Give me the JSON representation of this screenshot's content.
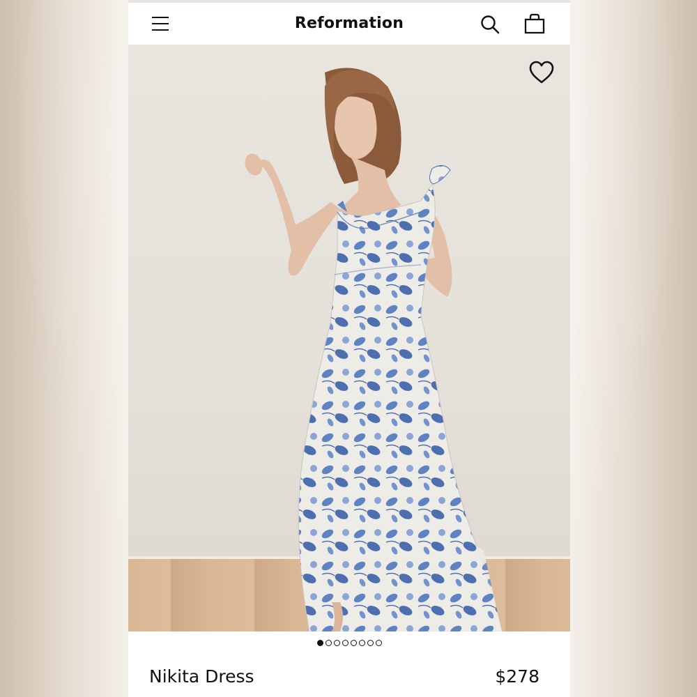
{
  "header": {
    "brand": "Reformation",
    "icons": [
      "menu-icon",
      "search-icon",
      "shopping-bag-icon"
    ]
  },
  "gallery": {
    "image_count": 8,
    "active_index": 0,
    "wishlist_icon": "heart-outline-icon"
  },
  "product": {
    "name": "Nikita Dress",
    "price": "$278"
  },
  "colors": {
    "text": "#111111",
    "dress_blue": "#5a7fbf",
    "dress_base": "#f1efe9"
  }
}
